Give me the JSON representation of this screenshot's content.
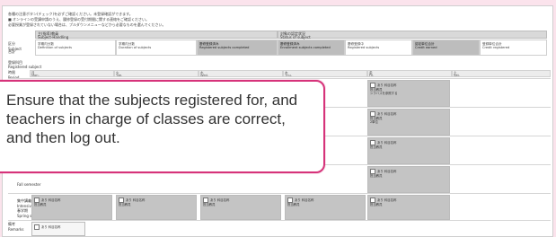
{
  "notice_lines": [
    "各種の注意ボタン(チェック)を必ずご確認ください。未登録確認ができます。",
    "■ オンラインの受講申請のうえ、履修登録の受付期間に関する連絡をご確認ください。",
    "必要授業が登録されていない場合は、プルダウンメニューなどから必要なものを選んでください。"
  ],
  "subject_heading": {
    "header_left_jp": "主(指導)教員",
    "header_left_en": "Subject-Handling",
    "header_right_jp": "対象の認定状況",
    "header_right_en": "Status of subject",
    "row_label_jp": "区分",
    "row_label_en": "Subject",
    "total_jp": "合計",
    "total_en": "Total",
    "cells": [
      {
        "jp": "学期内分数",
        "en": "Definition of subjects",
        "style": "white"
      },
      {
        "jp": "学期内分数",
        "en": "Duration of subjects",
        "style": "white"
      },
      {
        "jp": "履修登録済み",
        "en": "Registered subjects completed",
        "style": "gray"
      },
      {
        "jp": "履修登録済み",
        "en": "Enrollment subjects completed",
        "style": "gray"
      },
      {
        "jp": "履修登録中",
        "en": "Registered subjects",
        "style": "white"
      },
      {
        "jp": "認定単位合計",
        "en": "Credit earned",
        "style": "gray"
      },
      {
        "jp": "登録単位合計",
        "en": "Credit registered",
        "style": "white"
      }
    ]
  },
  "registered": {
    "jp": "登録科目",
    "en": "Registered subject"
  },
  "days": [
    {
      "jp": "月",
      "en": "Mon."
    },
    {
      "jp": "火",
      "en": "Tue."
    },
    {
      "jp": "水",
      "en": "Wed."
    },
    {
      "jp": "木",
      "en": "Thu."
    },
    {
      "jp": "金",
      "en": "Fri."
    },
    {
      "jp": "土",
      "en": "Sat."
    }
  ],
  "side_labels": {
    "period_jp": "時限",
    "period_en": "Period",
    "term_en": "Term",
    "fall_en": "Fall semester",
    "spring_jp": "春学期",
    "spring_en": "Spring semester",
    "intensive_jp": "集中講義",
    "intensive_en": "Intensive course",
    "remarks_jp": "備考",
    "remarks_en": "Remarks"
  },
  "slot_text": {
    "course_tag": "あり 科目名称",
    "teacher": "担当教員",
    "hours": "2単位",
    "link": "シラバスを参照する"
  },
  "callout": {
    "text": "Ensure that the subjects registered for, and teachers in charge of classes are correct, and then log out."
  },
  "colors": {
    "background": "#fbe3ec",
    "accent": "#d6337a",
    "slot_dark": "#c4c4c4"
  }
}
